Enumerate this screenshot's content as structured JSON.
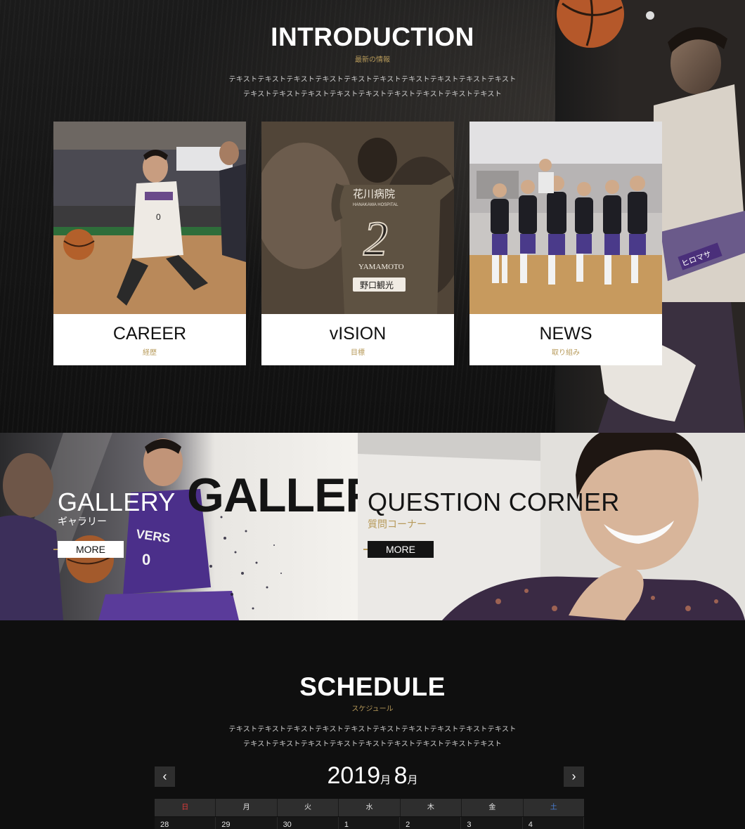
{
  "intro": {
    "title": "INTRODUCTION",
    "subtitle": "最新の情報",
    "text_line1": "テキストテキストテキストテキストテキストテキストテキストテキストテキストテキスト",
    "text_line2": "テキストテキストテキストテキストテキストテキストテキストテキストテキスト"
  },
  "cards": [
    {
      "label": "CAREER",
      "sub": "経歴"
    },
    {
      "label": "vISION",
      "sub": "目標"
    },
    {
      "label": "NEWS",
      "sub": "取り組み"
    }
  ],
  "photo_text": {
    "vision_jersey_sponsor": "花川病院",
    "vision_jersey_sponsor_en": "HANAKAWA HOSPITAL",
    "vision_jersey_number": "2",
    "vision_jersey_name": "YAMAMOTO",
    "vision_jersey_patch": "野口観光",
    "career_jersey_number": "0",
    "gallery_jersey_brand": "VERS",
    "gallery_jersey_number": "0"
  },
  "gallery": {
    "title": "GALLERY",
    "subtitle": "ギャラリー",
    "watermark": "GALLERY",
    "more_label": "MORE"
  },
  "question": {
    "title": "QUESTION CORNER",
    "subtitle": "質問コーナー",
    "more_label": "MORE"
  },
  "schedule": {
    "title": "SCHEDULE",
    "subtitle": "スケジュール",
    "text_line1": "テキストテキストテキストテキストテキストテキストテキストテキストテキストテキスト",
    "text_line2": "テキストテキストテキストテキストテキストテキストテキストテキストテキスト",
    "year": "2019",
    "year_unit": "月",
    "month": "8",
    "month_unit": "月",
    "prev_label": "‹",
    "next_label": "›",
    "weekdays": [
      "日",
      "月",
      "火",
      "水",
      "木",
      "金",
      "土"
    ],
    "first_row_days": [
      "28",
      "29",
      "30",
      "1",
      "2",
      "3",
      "4"
    ]
  },
  "colors": {
    "accent_gold": "#b79a5a",
    "sunday_red": "#e23b3b",
    "saturday_blue": "#4a7fd6",
    "dark_bg": "#0f0f0f",
    "calendar_header": "#2e2e2e"
  }
}
